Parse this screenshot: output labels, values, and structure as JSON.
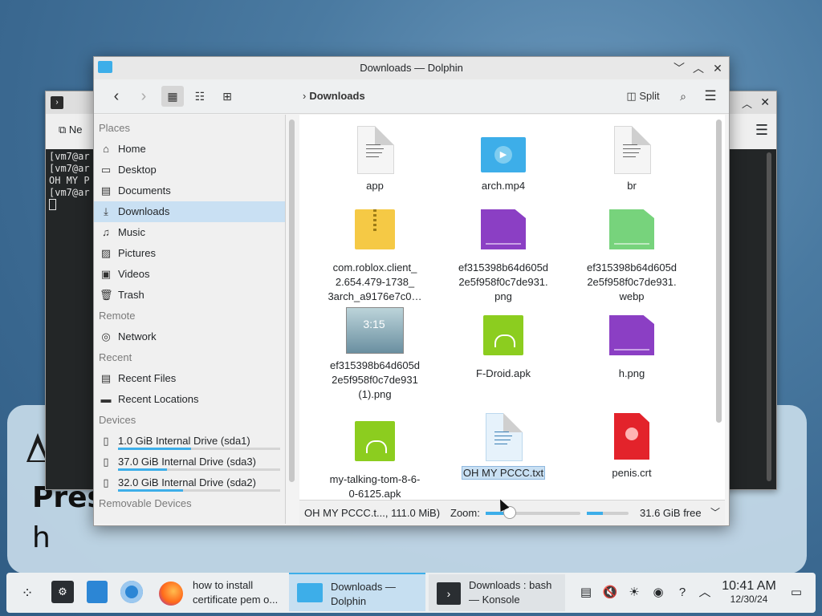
{
  "wallpaper": {
    "partial_top_text": "",
    "left_mid": "Pres",
    "left_low": "h"
  },
  "konsole": {
    "new_tab_label": "Ne",
    "terminal_lines": [
      "[vm7@ar",
      "[vm7@ar",
      "OH MY P",
      "[vm7@ar"
    ]
  },
  "dolphin": {
    "window_title": "Downloads — Dolphin",
    "breadcrumb": "Downloads",
    "split_label": "Split",
    "places": {
      "places_header": "Places",
      "items": [
        {
          "label": "Home",
          "icon": "home-icon"
        },
        {
          "label": "Desktop",
          "icon": "desktop-icon"
        },
        {
          "label": "Documents",
          "icon": "documents-icon"
        },
        {
          "label": "Downloads",
          "icon": "downloads-icon"
        },
        {
          "label": "Music",
          "icon": "music-icon"
        },
        {
          "label": "Pictures",
          "icon": "pictures-icon"
        },
        {
          "label": "Videos",
          "icon": "videos-icon"
        },
        {
          "label": "Trash",
          "icon": "trash-icon"
        }
      ],
      "remote_header": "Remote",
      "network": "Network",
      "recent_header": "Recent",
      "recent_files": "Recent Files",
      "recent_locations": "Recent Locations",
      "devices_header": "Devices",
      "devices": [
        {
          "label": "1.0 GiB Internal Drive (sda1)",
          "usage": 0.45
        },
        {
          "label": "37.0 GiB Internal Drive (sda3)",
          "usage": 0.3
        },
        {
          "label": "32.0 GiB Internal Drive (sda2)",
          "usage": 0.4
        }
      ],
      "removable_header": "Removable Devices"
    },
    "files": [
      {
        "name": "app",
        "type": "text"
      },
      {
        "name": "arch.mp4",
        "type": "video"
      },
      {
        "name": "br",
        "type": "text"
      },
      {
        "name": "com.roblox.client_\n2.654.479-1738_\n3arch_a9176e7c0…",
        "type": "archive"
      },
      {
        "name": "ef315398b64d605d\n2e5f958f0c7de931.\npng",
        "type": "image-purple"
      },
      {
        "name": "ef315398b64d605d\n2e5f958f0c7de931.\nwebp",
        "type": "image-green"
      },
      {
        "name": "ef315398b64d605d\n2e5f958f0c7de931\n(1).png",
        "type": "thumbnail"
      },
      {
        "name": "F-Droid.apk",
        "type": "apk"
      },
      {
        "name": "h.png",
        "type": "image-purple"
      },
      {
        "name": "my-talking-tom-8-6-\n0-6125.apk",
        "type": "apk"
      },
      {
        "name": "OH MY PCCC.txt",
        "type": "text-blue",
        "selected": true
      },
      {
        "name": "penis.crt",
        "type": "cert"
      }
    ],
    "thumbnail_time": "3:15",
    "status": {
      "selection": "OH MY PCCC.t..., 111.0 MiB)",
      "zoom_label": "Zoom:",
      "free_space": "31.6 GiB free"
    }
  },
  "taskbar": {
    "tasks": [
      {
        "label": "how to install\ncertificate pem o...",
        "icon": "firefox-icon"
      },
      {
        "label": "Downloads —\nDolphin",
        "icon": "folder-icon",
        "active": true
      },
      {
        "label": "Downloads : bash\n— Konsole",
        "icon": "konsole-icon"
      }
    ],
    "clock_time": "10:41 AM",
    "clock_date": "12/30/24"
  },
  "colors": {
    "accent": "#3daee9",
    "selection": "#c9e0f3",
    "taskbar": "#eceff1"
  }
}
